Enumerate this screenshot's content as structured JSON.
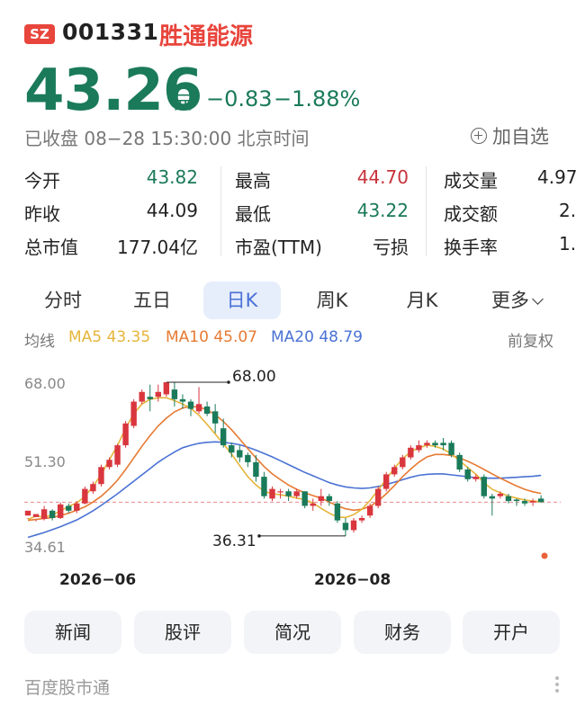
{
  "header": {
    "exchange": "SZ",
    "code": "001331",
    "name": "胜通能源"
  },
  "quote": {
    "price": "43.26",
    "unit": "元",
    "change": "−0.83",
    "change_pct": "−1.88%",
    "status": "已收盘 08−28 15:30:00 北京时间",
    "add_watchlist": "加自选"
  },
  "stats": {
    "open_label": "今开",
    "open": "43.82",
    "high_label": "最高",
    "high": "44.70",
    "volume_label": "成交量",
    "volume": "4.97",
    "prev_close_label": "昨收",
    "prev_close": "44.09",
    "low_label": "最低",
    "low": "43.22",
    "turnover_label": "成交额",
    "turnover": "2.",
    "mcap_label": "总市值",
    "mcap": "177.04亿",
    "pe_label": "市盈(TTM)",
    "pe": "亏损",
    "turnover_rate_label": "换手率",
    "turnover_rate": "1."
  },
  "tabs": [
    {
      "label": "分时"
    },
    {
      "label": "五日"
    },
    {
      "label": "日K",
      "active": true
    },
    {
      "label": "周K"
    },
    {
      "label": "月K"
    },
    {
      "label": "更多"
    }
  ],
  "ma_legend": {
    "title": "均线",
    "ma5": "MA5 43.35",
    "ma10": "MA10 45.07",
    "ma20": "MA20 48.79",
    "adjust": "前复权",
    "colors": {
      "ma5": "#e6b53a",
      "ma10": "#e67a32",
      "ma20": "#4a72d4"
    }
  },
  "chart_data": {
    "type": "candlestick",
    "y_labels": [
      "68.00",
      "51.30",
      "34.61"
    ],
    "x_labels": [
      "2026−06",
      "2026−08"
    ],
    "max_label": "68.00",
    "min_label": "36.31",
    "last_close": 43.26,
    "up_color": "#d9363e",
    "down_color": "#1a7a5a",
    "candles": [
      [
        40.5,
        41.5,
        40.0,
        39.8
      ],
      [
        40.2,
        40.8,
        39.6,
        39.3
      ],
      [
        39.8,
        41.8,
        39.5,
        42.5
      ],
      [
        41.5,
        40.0,
        39.5,
        41.8
      ],
      [
        40.0,
        42.8,
        39.8,
        43.2
      ],
      [
        42.5,
        41.5,
        41.0,
        43.0
      ],
      [
        41.5,
        43.0,
        41.0,
        43.5
      ],
      [
        43.0,
        46.0,
        42.8,
        46.5
      ],
      [
        45.5,
        47.0,
        45.0,
        47.5
      ],
      [
        47.0,
        50.5,
        46.5,
        51.0
      ],
      [
        50.5,
        52.0,
        50.0,
        52.5
      ],
      [
        51.0,
        55.0,
        50.5,
        55.3
      ],
      [
        55.0,
        59.5,
        54.5,
        60.0
      ],
      [
        59.0,
        64.0,
        58.5,
        64.5
      ],
      [
        64.0,
        66.0,
        63.5,
        66.5
      ],
      [
        65.0,
        64.5,
        62.0,
        67.5
      ],
      [
        65.0,
        66.0,
        64.0,
        67.5
      ],
      [
        65.5,
        68.0,
        65.0,
        68.0
      ],
      [
        66.5,
        64.5,
        63.0,
        68.0
      ],
      [
        64.5,
        64.0,
        62.5,
        65.5
      ],
      [
        64.0,
        62.5,
        61.0,
        64.5
      ],
      [
        62.0,
        63.5,
        61.5,
        67.0
      ],
      [
        63.0,
        61.5,
        61.0,
        64.0
      ],
      [
        62.0,
        59.5,
        57.5,
        63.5
      ],
      [
        58.5,
        55.0,
        54.5,
        60.5
      ],
      [
        55.0,
        53.5,
        52.5,
        55.5
      ],
      [
        54.0,
        52.5,
        51.5,
        55.0
      ],
      [
        53.0,
        51.5,
        50.5,
        53.5
      ],
      [
        51.5,
        48.5,
        47.5,
        53.0
      ],
      [
        48.5,
        44.5,
        44.0,
        49.5
      ],
      [
        44.0,
        46.0,
        43.5,
        46.5
      ],
      [
        45.5,
        45.5,
        44.0,
        46.0
      ],
      [
        45.5,
        44.5,
        43.5,
        46.0
      ],
      [
        44.5,
        45.5,
        44.0,
        46.0
      ],
      [
        45.5,
        42.5,
        42.0,
        45.5
      ],
      [
        42.5,
        43.0,
        41.5,
        44.0
      ],
      [
        43.5,
        44.5,
        42.5,
        46.0
      ],
      [
        44.5,
        43.5,
        42.5,
        45.0
      ],
      [
        43.0,
        39.5,
        39.0,
        43.5
      ],
      [
        39.0,
        37.5,
        36.3,
        40.0
      ],
      [
        37.5,
        39.5,
        37.0,
        40.0
      ],
      [
        39.5,
        40.0,
        39.0,
        40.5
      ],
      [
        40.5,
        42.5,
        40.0,
        43.0
      ],
      [
        42.5,
        46.0,
        42.0,
        46.5
      ],
      [
        46.0,
        49.0,
        45.5,
        49.5
      ],
      [
        49.0,
        50.5,
        48.5,
        51.0
      ],
      [
        50.5,
        52.5,
        50.0,
        53.0
      ],
      [
        52.5,
        54.5,
        52.0,
        55.0
      ],
      [
        54.0,
        55.0,
        53.5,
        56.0
      ],
      [
        55.0,
        55.5,
        54.5,
        56.0
      ],
      [
        55.5,
        55.0,
        54.5,
        56.0
      ],
      [
        55.5,
        55.0,
        54.0,
        56.5
      ],
      [
        55.5,
        53.0,
        52.5,
        56.0
      ],
      [
        53.0,
        50.0,
        49.5,
        53.5
      ],
      [
        50.0,
        48.0,
        47.5,
        50.5
      ],
      [
        48.0,
        48.5,
        47.5,
        49.0
      ],
      [
        48.5,
        44.5,
        44.0,
        49.0
      ],
      [
        44.5,
        44.0,
        40.5,
        45.0
      ],
      [
        44.5,
        45.0,
        44.0,
        45.5
      ],
      [
        44.5,
        43.5,
        43.0,
        45.0
      ],
      [
        43.8,
        43.5,
        42.5,
        44.0
      ],
      [
        43.5,
        43.0,
        42.5,
        44.0
      ],
      [
        43.2,
        43.5,
        42.5,
        44.0
      ],
      [
        44.0,
        43.26,
        43.22,
        44.7
      ]
    ],
    "ma5": [
      39.7,
      40.4,
      40.2,
      40.6,
      41.5,
      42.4,
      43.1,
      44.5,
      46.5,
      49.0,
      52.0,
      55.0,
      58.5,
      61.5,
      63.5,
      64.5,
      64.8,
      64.8,
      64.2,
      63.5,
      62.6,
      61.2,
      59.3,
      57.3,
      55.3,
      53.2,
      50.8,
      48.5,
      46.8,
      45.5,
      45.0,
      44.8,
      44.5,
      44.1,
      43.8,
      43.1,
      42.0,
      41.0,
      40.2,
      40.1,
      40.7,
      41.8,
      43.6,
      45.8,
      48.0,
      50.3,
      52.2,
      53.7,
      54.5,
      55.0,
      54.8,
      54.2,
      53.2,
      51.8,
      50.4,
      49.0,
      47.3,
      45.9,
      45.2,
      44.5,
      44.1,
      43.7,
      43.5,
      43.35
    ],
    "ma10": [
      39.5,
      39.7,
      39.9,
      40.1,
      40.5,
      41.0,
      41.6,
      42.3,
      43.3,
      44.5,
      46.0,
      47.8,
      50.0,
      52.4,
      54.8,
      57.0,
      59.0,
      60.6,
      61.9,
      62.7,
      63.0,
      62.9,
      62.3,
      61.3,
      59.9,
      58.2,
      56.3,
      54.3,
      52.4,
      50.6,
      49.1,
      47.9,
      46.8,
      45.9,
      45.2,
      44.6,
      44.1,
      43.3,
      42.5,
      41.9,
      41.6,
      41.8,
      42.4,
      43.5,
      45.0,
      46.7,
      48.5,
      50.1,
      51.5,
      52.6,
      53.1,
      53.1,
      52.9,
      52.4,
      51.7,
      50.9,
      50.0,
      49.1,
      48.2,
      47.4,
      46.6,
      45.9,
      45.4,
      45.07
    ],
    "ma20": [
      36.0,
      36.5,
      37.0,
      37.6,
      38.2,
      38.9,
      39.6,
      40.5,
      41.5,
      42.6,
      43.8,
      45.0,
      46.3,
      47.6,
      48.9,
      50.2,
      51.5,
      52.6,
      53.6,
      54.5,
      55.0,
      55.4,
      55.6,
      55.7,
      55.6,
      55.4,
      55.1,
      54.6,
      54.0,
      53.3,
      52.6,
      51.8,
      51.0,
      50.2,
      49.4,
      48.7,
      48.0,
      47.3,
      46.8,
      46.4,
      46.2,
      46.1,
      46.2,
      46.5,
      46.9,
      47.4,
      47.9,
      48.4,
      48.8,
      49.0,
      49.1,
      49.1,
      48.9,
      48.7,
      48.5,
      48.3,
      48.2,
      48.2,
      48.2,
      48.3,
      48.4,
      48.5,
      48.6,
      48.79
    ]
  },
  "actions": [
    {
      "label": "新闻"
    },
    {
      "label": "股评"
    },
    {
      "label": "简况"
    },
    {
      "label": "财务"
    },
    {
      "label": "开户"
    }
  ],
  "footer": {
    "brand": "百度股市通"
  }
}
